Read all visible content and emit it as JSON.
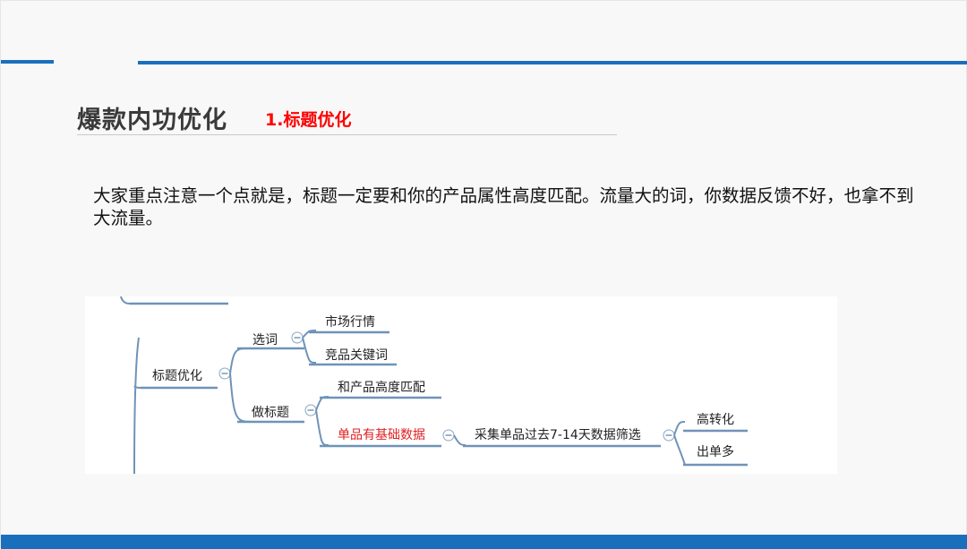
{
  "slide": {
    "title": "爆款内功优化",
    "subtitle": "1.标题优化",
    "body": "大家重点注意一个点就是，标题一定要和你的产品属性高度匹配。流量大的词，你数据反馈不好，也拿不到大流量。"
  },
  "mindmap": {
    "root": "标题优化",
    "branch_select": "选词",
    "leaf_market": "市场行情",
    "leaf_competitor": "竞品关键词",
    "branch_make": "做标题",
    "leaf_match": "和产品高度匹配",
    "leaf_single": "单品有基础数据",
    "leaf_collect": "采集单品过去7-14天数据筛选",
    "leaf_high": "高转化",
    "leaf_orders": "出单多"
  },
  "colors": {
    "accent": "#1a6fbd",
    "subtitle": "#ff0000",
    "highlight_node": "#e02020",
    "branch_line": "#6f93b8"
  }
}
